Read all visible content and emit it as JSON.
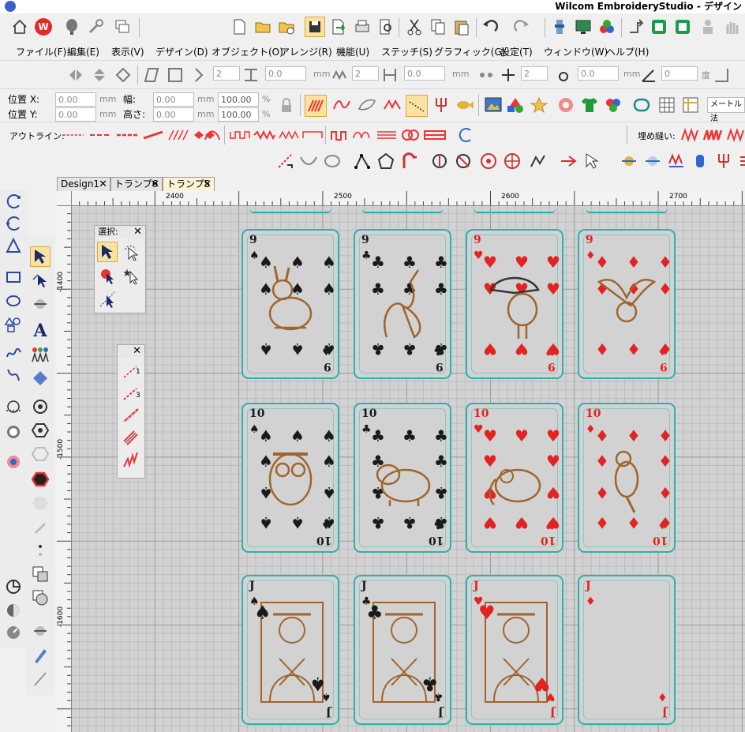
{
  "window": {
    "title": "Wilcom EmbroideryStudio - デザイン"
  },
  "menu": [
    "ファイル(F)",
    "編集(E)",
    "表示(V)",
    "デザイン(D)",
    "オブジェクト(O)",
    "アレンジ(R)",
    "機能(U)",
    "ステッチ(S)",
    "グラフィック(G)",
    "設定(T)",
    "ウィンドウ(W)",
    "ヘルプ(H)"
  ],
  "transform_bar": {
    "fields": [
      "2",
      "0.0",
      "2",
      "0.0",
      "2",
      "0.0",
      "0"
    ],
    "unit_mm": "mm",
    "unit_deg": "度"
  },
  "position_bar": {
    "pos_x_label": "位置 X:",
    "pos_y_label": "位置 Y:",
    "width_label": "幅:",
    "height_label": "高さ:",
    "pos_x": "0.00",
    "pos_y": "0.00",
    "width": "0.00",
    "height": "0.00",
    "scale_x": "100.00",
    "scale_y": "100.00",
    "unit_mm": "mm",
    "unit_pct": "%",
    "method_select": "メートル法"
  },
  "outline_bar": {
    "label": "アウトライン:",
    "fill_label": "埋め縫い:"
  },
  "tabs": [
    {
      "label": "Design1",
      "active": false
    },
    {
      "label": "トランプ6",
      "active": false
    },
    {
      "label": "トランプ5",
      "active": true
    }
  ],
  "ruler": {
    "h": [
      "2400",
      "2500",
      "2600",
      "2700"
    ],
    "v": [
      "-1400",
      "-1500",
      "-1600"
    ]
  },
  "select_panel": {
    "title": "選択:"
  },
  "cards": [
    {
      "rank": "9",
      "suit": "♠",
      "color": "#1a1a1a",
      "picture": "rabbit"
    },
    {
      "rank": "9",
      "suit": "♣",
      "color": "#1a1a1a",
      "picture": "kangaroo"
    },
    {
      "rank": "9",
      "suit": "♥",
      "color": "#e32222",
      "picture": "toucan"
    },
    {
      "rank": "9",
      "suit": "♦",
      "color": "#e32222",
      "picture": "bird"
    },
    {
      "rank": "10",
      "suit": "♠",
      "color": "#1a1a1a",
      "picture": "owl"
    },
    {
      "rank": "10",
      "suit": "♣",
      "color": "#1a1a1a",
      "picture": "hippo"
    },
    {
      "rank": "10",
      "suit": "♥",
      "color": "#e32222",
      "picture": "elephant"
    },
    {
      "rank": "10",
      "suit": "♦",
      "color": "#e32222",
      "picture": "parrot"
    },
    {
      "rank": "J",
      "suit": "♠",
      "color": "#1a1a1a",
      "picture": "jack"
    },
    {
      "rank": "J",
      "suit": "♣",
      "color": "#1a1a1a",
      "picture": "jack"
    },
    {
      "rank": "J",
      "suit": "♥",
      "color": "#e32222",
      "picture": "jack"
    },
    {
      "rank": "J",
      "suit": "♦",
      "color": "#e32222",
      "picture": "blank"
    }
  ],
  "colors": {
    "accent": "#2fb0b0",
    "stitch_brown": "#a0642c",
    "stitch_red": "#e32222",
    "active_tab": "#fbf3d6"
  }
}
